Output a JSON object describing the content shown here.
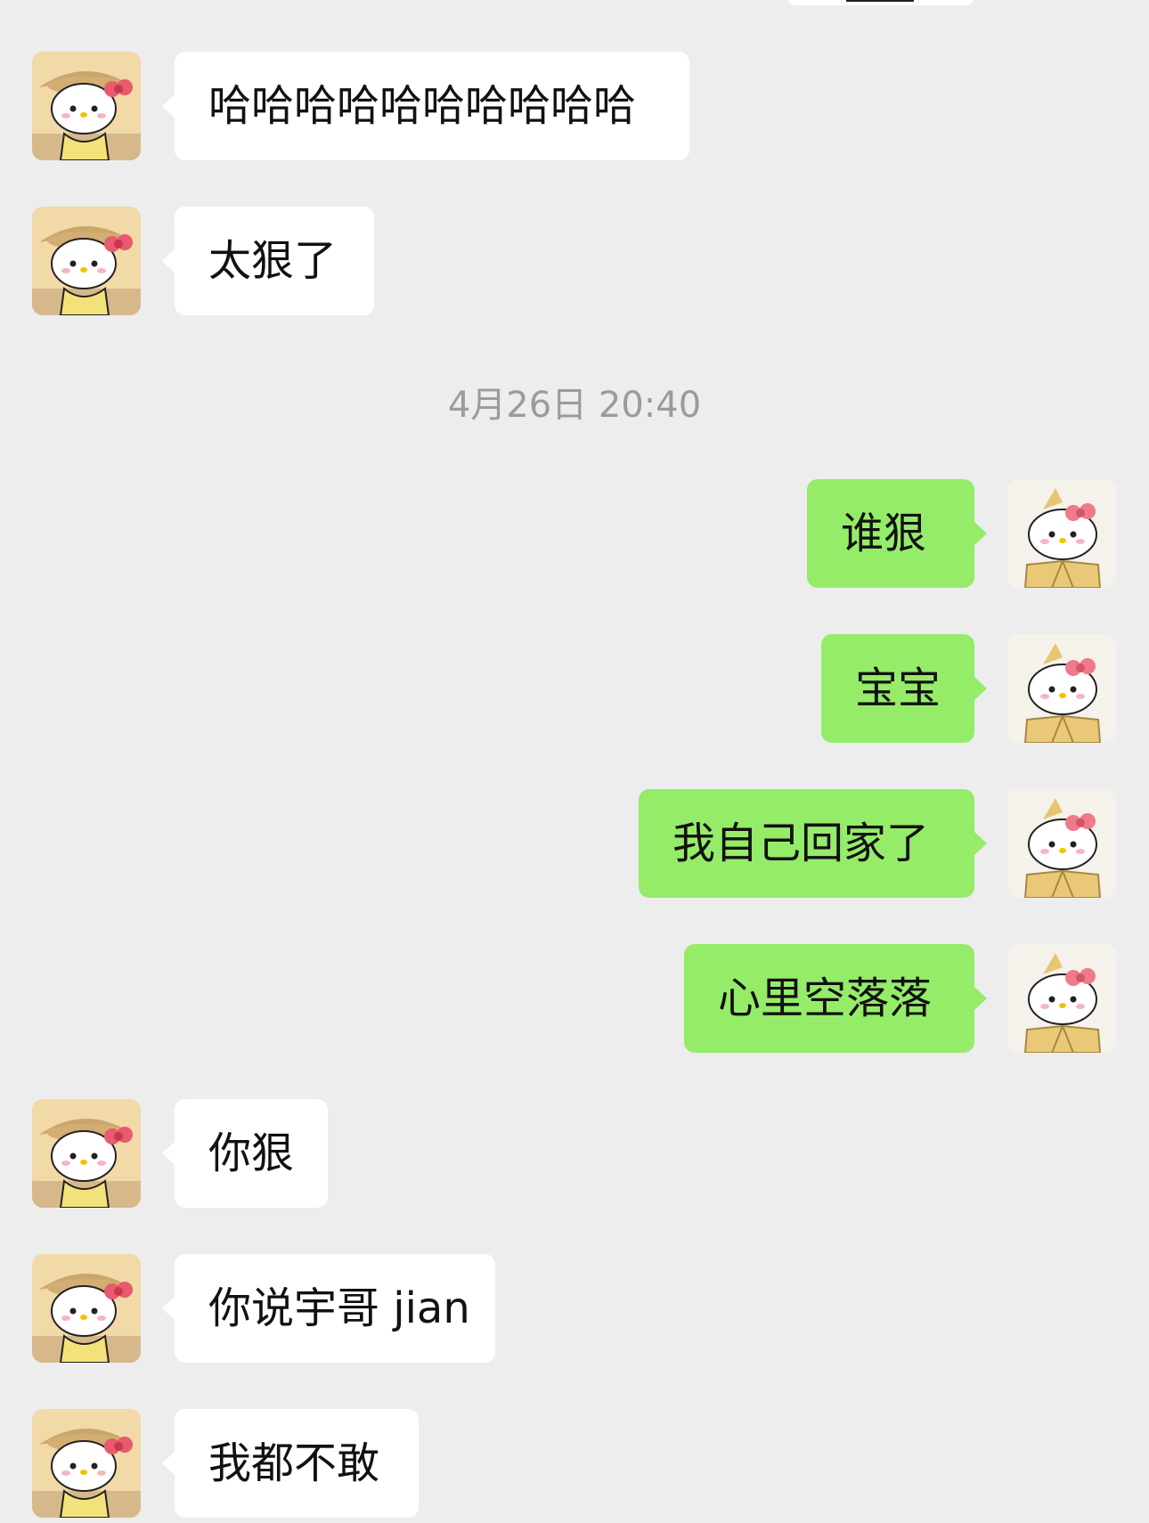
{
  "chat": {
    "messages_before": [
      {
        "text": "哈哈哈哈哈哈哈哈哈哈",
        "from": "other"
      },
      {
        "text": "太狠了",
        "from": "other"
      }
    ],
    "timestamp": "4月26日 20:40",
    "messages_after_self": [
      {
        "text": "谁狠",
        "from": "self"
      },
      {
        "text": "宝宝",
        "from": "self"
      },
      {
        "text": "我自己回家了",
        "from": "self"
      },
      {
        "text": "心里空落落",
        "from": "self"
      }
    ],
    "messages_after_other": [
      {
        "text": "你狠",
        "from": "other"
      },
      {
        "text": "你说宇哥 jian",
        "from": "other"
      },
      {
        "text": "我都不敢",
        "from": "other"
      }
    ]
  },
  "avatars": {
    "other": "hello-kitty-straw-hat-avatar",
    "self": "hello-kitty-kimono-avatar"
  },
  "colors": {
    "background": "#ededed",
    "incoming_bubble": "#ffffff",
    "outgoing_bubble": "#95ec69",
    "timestamp_text": "#9b9b9b"
  }
}
